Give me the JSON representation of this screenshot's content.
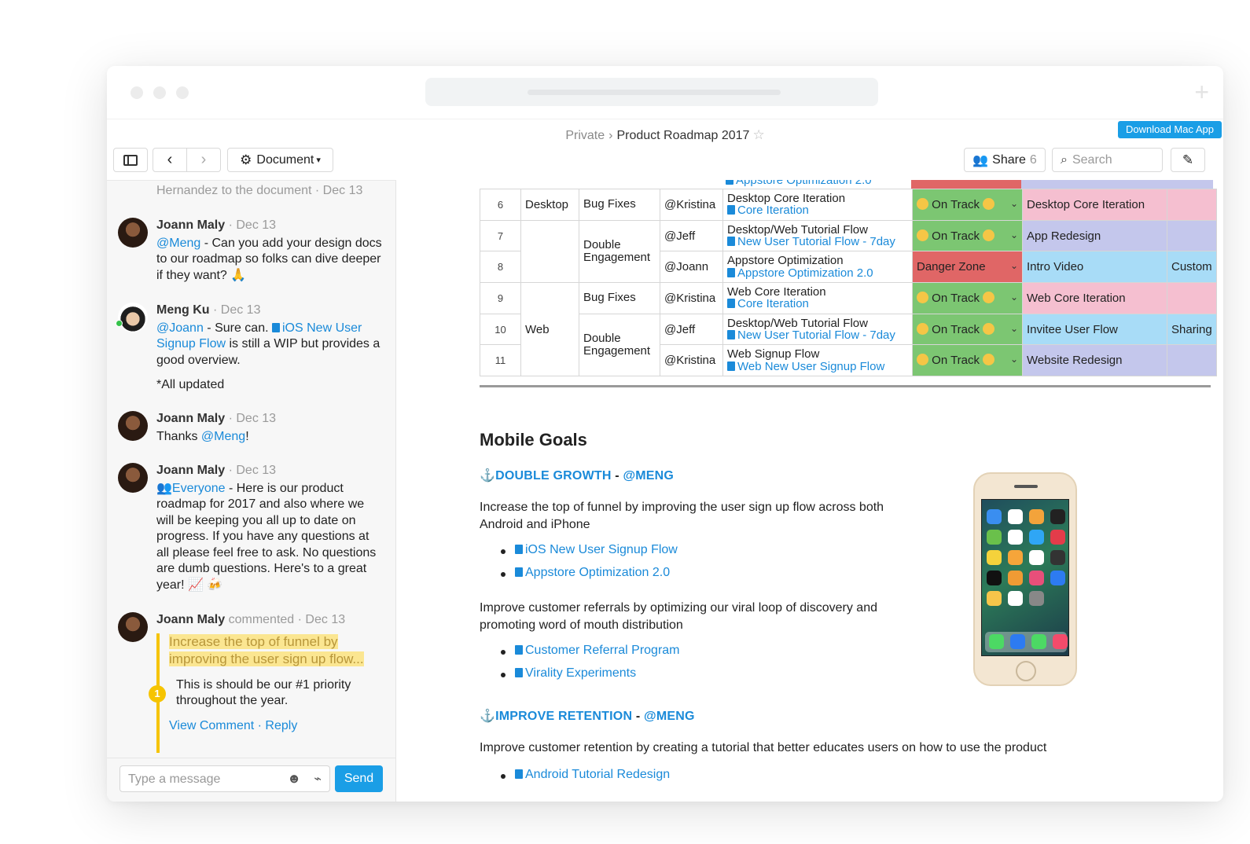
{
  "window": {
    "breadcrumb_private": "Private",
    "breadcrumb_sep": "›",
    "doc_title": "Product Roadmap 2017",
    "download_label": "Download Mac App"
  },
  "toolbar": {
    "document_label": "Document",
    "share_label": "Share",
    "share_count": "6",
    "search_placeholder": "Search"
  },
  "chat": {
    "top_fragment": "Hernandez to the document · Dec 13",
    "messages": [
      {
        "author": "Joann Maly",
        "date": "Dec 13",
        "mention": "@Meng",
        "text": " - Can you add your design docs to our roadmap so folks can dive deeper if they want? 🙏"
      },
      {
        "author": "Meng Ku",
        "date": "Dec 13",
        "mention": "@Joann",
        "text_a": " - Sure can. ",
        "doclink": "iOS New User Signup Flow",
        "text_b": " is still a WIP but provides a good overview.",
        "extra": "*All updated"
      },
      {
        "author": "Joann Maly",
        "date": "Dec 13",
        "text_a": "Thanks ",
        "mention": "@Meng",
        "text_b": "!"
      },
      {
        "author": "Joann Maly",
        "date": "Dec 13",
        "mention": "Everyone",
        "text": " - Here is our product roadmap for 2017 and also where we will be keeping you all up to date on progress. If you have any questions at all please feel free to ask. No questions are dumb questions. Here's to a great year! 📈 🍻"
      },
      {
        "author": "Joann Maly",
        "action": "commented",
        "date": "Dec 13",
        "quote": "Increase the top of funnel by improving the user sign up flow...",
        "badge": "1",
        "comment": "This is should be our #1 priority throughout the year.",
        "view": "View Comment",
        "dot": "·",
        "reply": "Reply"
      }
    ],
    "input_placeholder": "Type a message",
    "send_label": "Send"
  },
  "table": {
    "partial_top": "Appstore Optimization 2.0",
    "rows": [
      {
        "num": "6",
        "platform": "Desktop",
        "type": "Bug Fixes",
        "owner": "@Kristina",
        "task": "Desktop Core Iteration",
        "link": "Core Iteration",
        "status": "On Track",
        "project": "Desktop Core Iteration",
        "extra": ""
      },
      {
        "num": "7",
        "platform": "",
        "type": "Double Engagement",
        "owner": "@Jeff",
        "task": "Desktop/Web Tutorial Flow",
        "link": "New User Tutorial Flow - 7day",
        "status": "On Track",
        "project": "App Redesign",
        "extra": ""
      },
      {
        "num": "8",
        "platform": "",
        "type": "",
        "owner": "@Joann",
        "task": "Appstore Optimization",
        "link": "Appstore Optimization 2.0",
        "status": "Danger Zone",
        "project": "Intro Video",
        "extra": "Custom"
      },
      {
        "num": "9",
        "platform": "Web",
        "type": "Bug Fixes",
        "owner": "@Kristina",
        "task": "Web Core Iteration",
        "link": "Core Iteration",
        "status": "On Track",
        "project": "Web Core Iteration",
        "extra": ""
      },
      {
        "num": "10",
        "platform": "",
        "type": "Double Engagement",
        "owner": "@Jeff",
        "task": "Desktop/Web Tutorial Flow",
        "link": "New User Tutorial Flow - 7day",
        "status": "On Track",
        "project": "Invitee User Flow",
        "extra": "Sharing"
      },
      {
        "num": "11",
        "platform": "",
        "type": "",
        "owner": "@Kristina",
        "task": "Web Signup Flow",
        "link": "Web New User Signup Flow",
        "status": "On Track",
        "project": "Website Redesign",
        "extra": ""
      }
    ]
  },
  "doc": {
    "heading": "Mobile Goals",
    "section1": {
      "title": "DOUBLE GROWTH",
      "dash": " - ",
      "owner": "@MENG",
      "p1": "Increase the top of funnel by improving the user sign up flow across both Android and iPhone",
      "links1": [
        "iOS New User Signup Flow",
        "Appstore Optimization 2.0"
      ],
      "p2": "Improve customer referrals by optimizing our viral loop of discovery and promoting word of mouth distribution",
      "links2": [
        "Customer Referral Program",
        "Virality Experiments"
      ]
    },
    "section2": {
      "title": "IMPROVE RETENTION",
      "dash": " - ",
      "owner": "@MENG",
      "p1": "Improve customer retention by creating a tutorial that better educates users on how to use the product",
      "links1": [
        "Android Tutorial Redesign"
      ]
    }
  },
  "colors": {
    "accent": "#1a9ee6",
    "on_track": "#7cc672",
    "danger": "#e06666",
    "pink": "#f5bfd0",
    "blue": "#a8dcf7",
    "purple": "#c4c7ec",
    "highlight": "#fbe691"
  }
}
